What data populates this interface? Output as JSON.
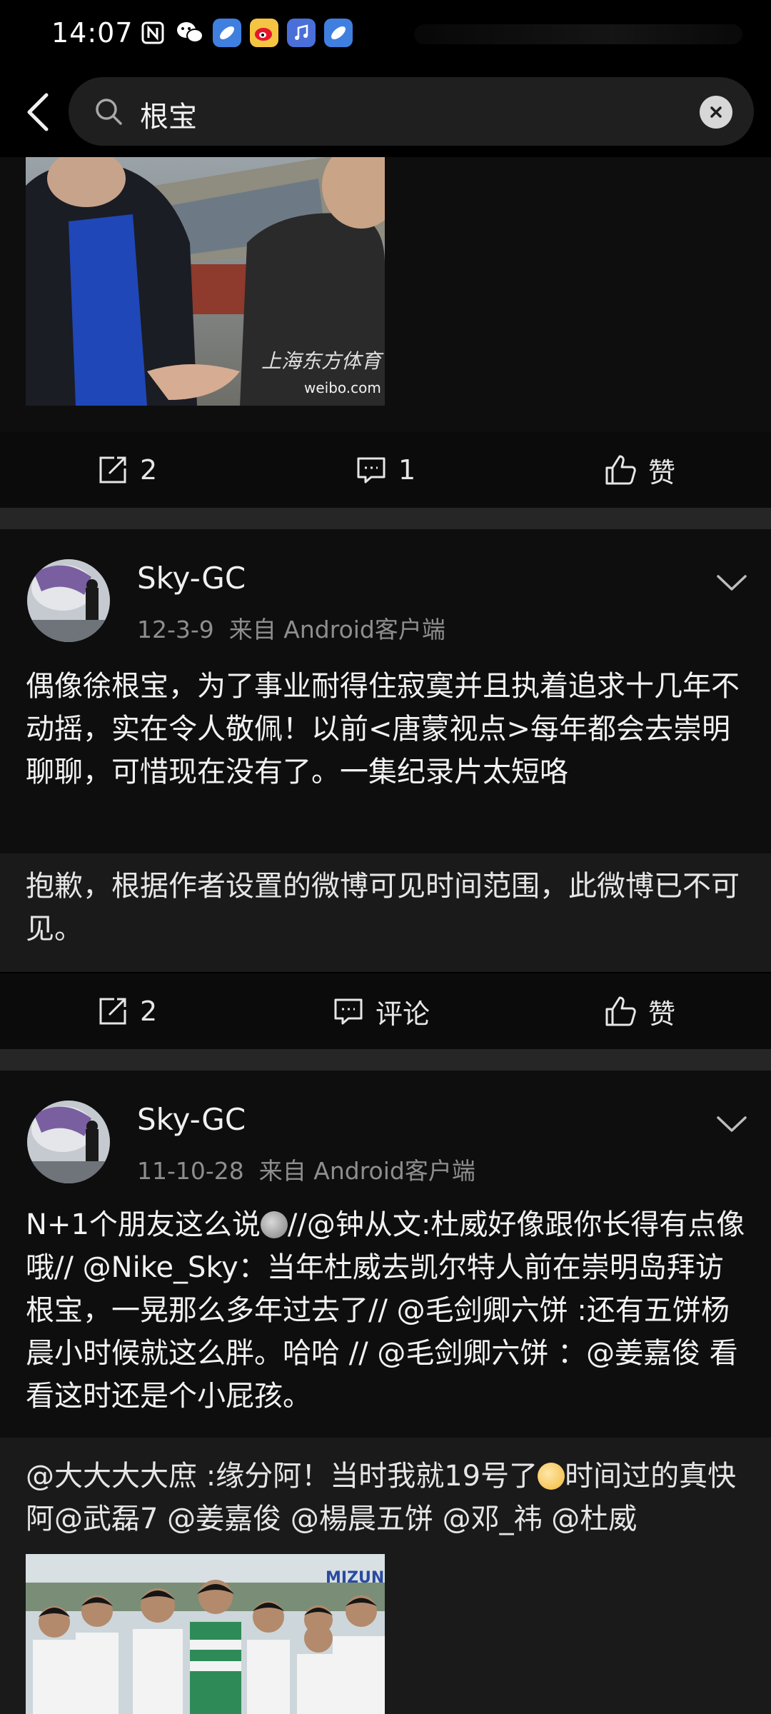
{
  "status_bar": {
    "time": "14:07",
    "icons": [
      "nfc-icon",
      "wechat-icon",
      "app-blue-icon",
      "weibo-icon",
      "music-icon",
      "app-blue-icon-2"
    ]
  },
  "search": {
    "query": "根宝"
  },
  "post1": {
    "photo_watermark": "weibo.com",
    "repost_count": "2",
    "comment_count": "1",
    "like_label": "赞"
  },
  "post2": {
    "username": "Sky-GC",
    "date": "12-3-9",
    "source": "来自 Android客户端",
    "text": "偶像徐根宝，为了事业耐得住寂寞并且执着追求十几年不动摇，实在令人敬佩！以前<唐蒙视点>每年都会去崇明聊聊，可惜现在没有了。一集纪录片太短咯",
    "repost_text": "抱歉，根据作者设置的微博可见时间范围，此微博已不可见。",
    "repost_count": "2",
    "comment_label": "评论",
    "like_label": "赞"
  },
  "post3": {
    "username": "Sky-GC",
    "date": "11-10-28",
    "source": "来自 Android客户端",
    "text_before_emoji": "N+1个朋友这么说",
    "text_after_emoji": "//@钟从文:杜威好像跟你长得有点像哦// @Nike_Sky：当年杜威去凯尔特人前在崇明岛拜访根宝，一晃那么多年过去了// @毛剑卿六饼 :还有五饼杨晨小时候就这么胖。哈哈 //  @毛剑卿六饼 ：@姜嘉俊  看看这时还是个小屁孩。",
    "repost_before_emoji": "@大大大大庶 :缘分阿！当时我就19号了",
    "repost_after_emoji": "时间过的真快阿@武磊7 @姜嘉俊 @楊晨五饼 @邓_祎 @杜威"
  },
  "colors": {
    "background": "#000000",
    "card": "#0e0e0e",
    "repost_box": "#1a1a1a",
    "separator": "#262626",
    "meta_text": "#8e8e8e"
  }
}
